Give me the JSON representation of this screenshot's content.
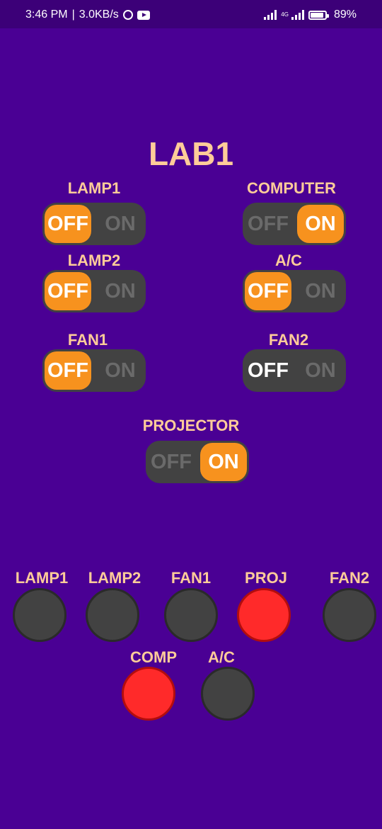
{
  "status_bar": {
    "time": "3:46 PM",
    "separator": "|",
    "speed": "3.0KB/s",
    "network": "4G",
    "battery": "89%"
  },
  "title": "LAB1",
  "switches": {
    "lamp1": {
      "label": "LAMP1",
      "off": "OFF",
      "on": "ON",
      "state": "off"
    },
    "computer": {
      "label": "COMPUTER",
      "off": "OFF",
      "on": "ON",
      "state": "on"
    },
    "lamp2": {
      "label": "LAMP2",
      "off": "OFF",
      "on": "ON",
      "state": "off"
    },
    "ac": {
      "label": "A/C",
      "off": "OFF",
      "on": "ON",
      "state": "off"
    },
    "fan1": {
      "label": "FAN1",
      "off": "OFF",
      "on": "ON",
      "state": "off"
    },
    "fan2": {
      "label": "FAN2",
      "off": "OFF",
      "on": "ON",
      "state": "off"
    },
    "projector": {
      "label": "PROJECTOR",
      "off": "OFF",
      "on": "ON",
      "state": "on"
    }
  },
  "indicators": {
    "lamp1": {
      "label": "LAMP1",
      "color": "#424242"
    },
    "lamp2": {
      "label": "LAMP2",
      "color": "#424242"
    },
    "fan1": {
      "label": "FAN1",
      "color": "#424242"
    },
    "proj": {
      "label": "PROJ",
      "color": "#ff2a2a"
    },
    "fan2": {
      "label": "FAN2",
      "color": "#424242"
    },
    "comp": {
      "label": "COMP",
      "color": "#ff2a2a"
    },
    "ac": {
      "label": "A/C",
      "color": "#424242"
    }
  },
  "colors": {
    "background": "#4a0094",
    "label": "#ffcc99",
    "thumb": "#f7921e",
    "track": "#424242",
    "indicator_on": "#ff2a2a",
    "indicator_off": "#424242"
  }
}
